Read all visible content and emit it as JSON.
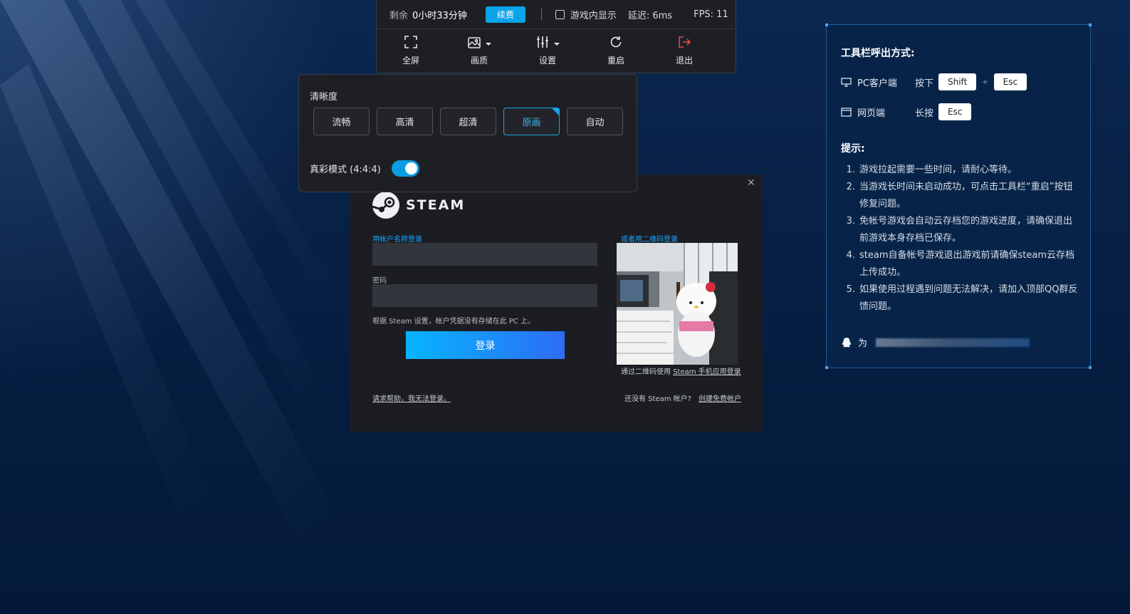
{
  "toolbar": {
    "remaining_label": "剩余",
    "remaining_value": "0小时33分钟",
    "renew_label": "续费",
    "show_in_game_label": "游戏内显示",
    "latency": "延迟: 6ms",
    "fps": "FPS: 11",
    "items": [
      {
        "label": "全屏",
        "icon": "fullscreen-icon"
      },
      {
        "label": "画质",
        "icon": "image-quality-icon"
      },
      {
        "label": "设置",
        "icon": "settings-sliders-icon"
      },
      {
        "label": "重启",
        "icon": "restart-icon"
      },
      {
        "label": "退出",
        "icon": "exit-icon"
      }
    ]
  },
  "clarity": {
    "title": "清晰度",
    "options": [
      "流畅",
      "高清",
      "超清",
      "原画",
      "自动"
    ],
    "selected": "原画",
    "true_color_label": "真彩模式 (4:4:4)",
    "true_color_on": true
  },
  "steam": {
    "brand": "STEAM",
    "account_label": "用帐户名称登录",
    "qr_label": "或者用二维码登录",
    "password_label": "密码",
    "remember_note": "根据 Steam 设置，帐户凭据没有存储在此 PC 上。",
    "login_button": "登录",
    "qr_caption_prefix": "通过二维码使用 ",
    "qr_caption_link": "Steam 手机应用登录",
    "help_link": "请求帮助，我无法登录。",
    "no_account": "还没有 Steam 帐户?",
    "create_account": "创建免费帐户"
  },
  "help_panel": {
    "title": "工具栏呼出方式:",
    "pc_label": "PC客户端",
    "pc_action": "按下",
    "pc_key1": "Shift",
    "pc_plus": "+",
    "pc_key2": "Esc",
    "web_label": "网页端",
    "web_action": "长按",
    "web_key": "Esc",
    "tips_title": "提示:",
    "tips": [
      "游戏拉起需要一些时间，请耐心等待。",
      "当游戏长时间未启动成功，可点击工具栏“重启”按钮修复问题。",
      "免帐号游戏会自动云存档您的游戏进度，请确保退出前游戏本身存档已保存。",
      "steam自备帐号游戏退出游戏前请确保steam云存档上传成功。",
      "如果使用过程遇到问题无法解决，请加入顶部QQ群反馈问题。"
    ],
    "qq_prefix": "为"
  },
  "colors": {
    "background": "#051a3a",
    "accent": "#0aa4e8",
    "exit": "#e8484b"
  }
}
